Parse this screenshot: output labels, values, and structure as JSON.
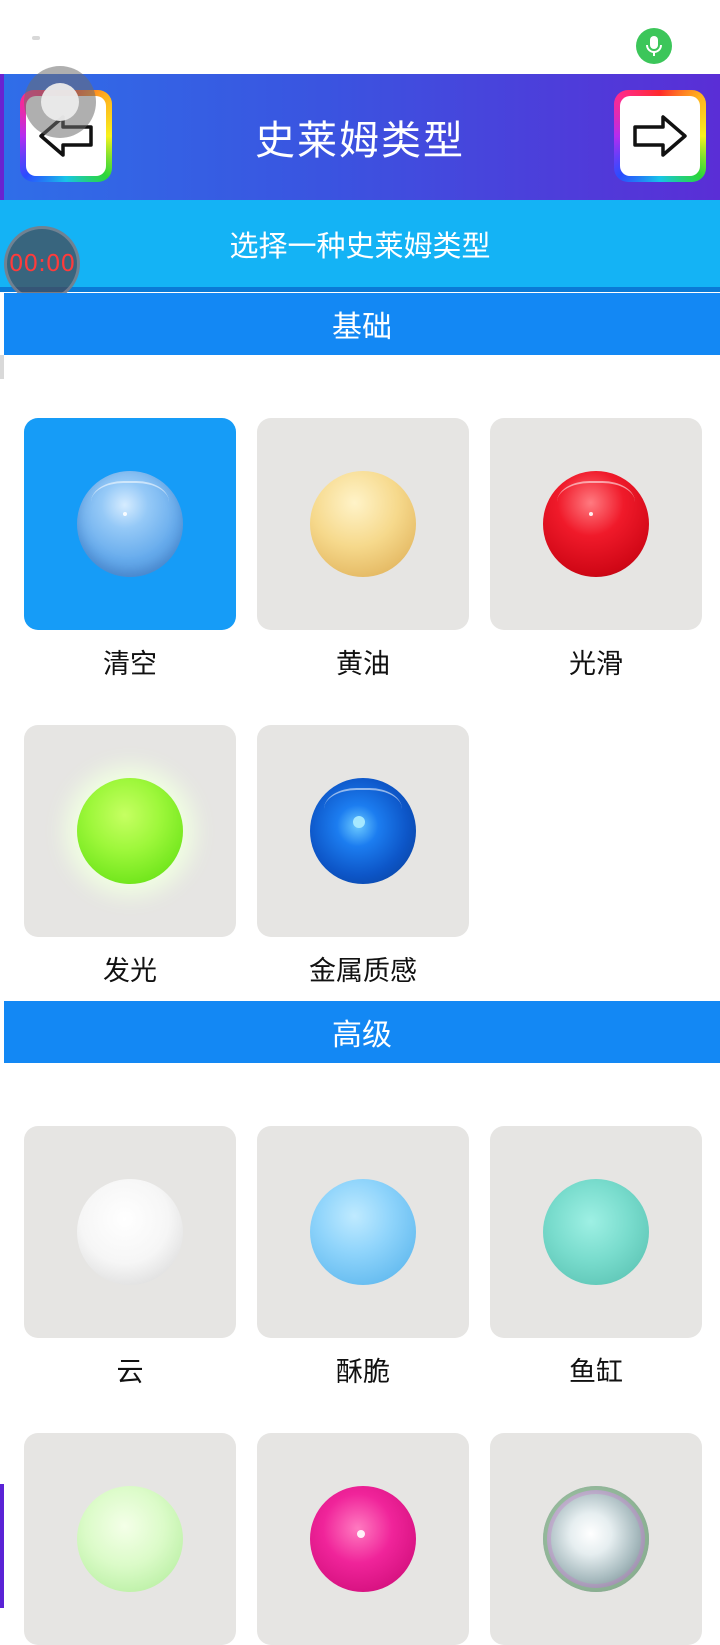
{
  "status_bar": {
    "mic_icon": "microphone-icon",
    "mic_color": "#3cc65a"
  },
  "header": {
    "title": "史莱姆类型",
    "back_icon": "arrow-left-icon",
    "forward_icon": "arrow-right-icon",
    "gradient": [
      "#2f6ee8",
      "#5a2ed6"
    ]
  },
  "subtitle": {
    "text": "选择一种史莱姆类型",
    "background": "#14b3f5"
  },
  "timer": {
    "text": "00:00",
    "color": "#ff3b3b"
  },
  "sections": [
    {
      "title": "基础",
      "items": [
        {
          "label": "清空",
          "selected": true
        },
        {
          "label": "黄油",
          "selected": false
        },
        {
          "label": "光滑",
          "selected": false
        },
        {
          "label": "发光",
          "selected": false
        },
        {
          "label": "金属质感",
          "selected": false
        }
      ]
    },
    {
      "title": "高级",
      "items": [
        {
          "label": "云",
          "selected": false
        },
        {
          "label": "酥脆",
          "selected": false
        },
        {
          "label": "鱼缸",
          "selected": false
        },
        {
          "label": "",
          "selected": false
        },
        {
          "label": "",
          "selected": false
        },
        {
          "label": "",
          "selected": false
        }
      ]
    }
  ],
  "colors": {
    "section_header": "#1388f4",
    "selected_tile": "#169cf7",
    "tile": "#e6e5e3"
  }
}
